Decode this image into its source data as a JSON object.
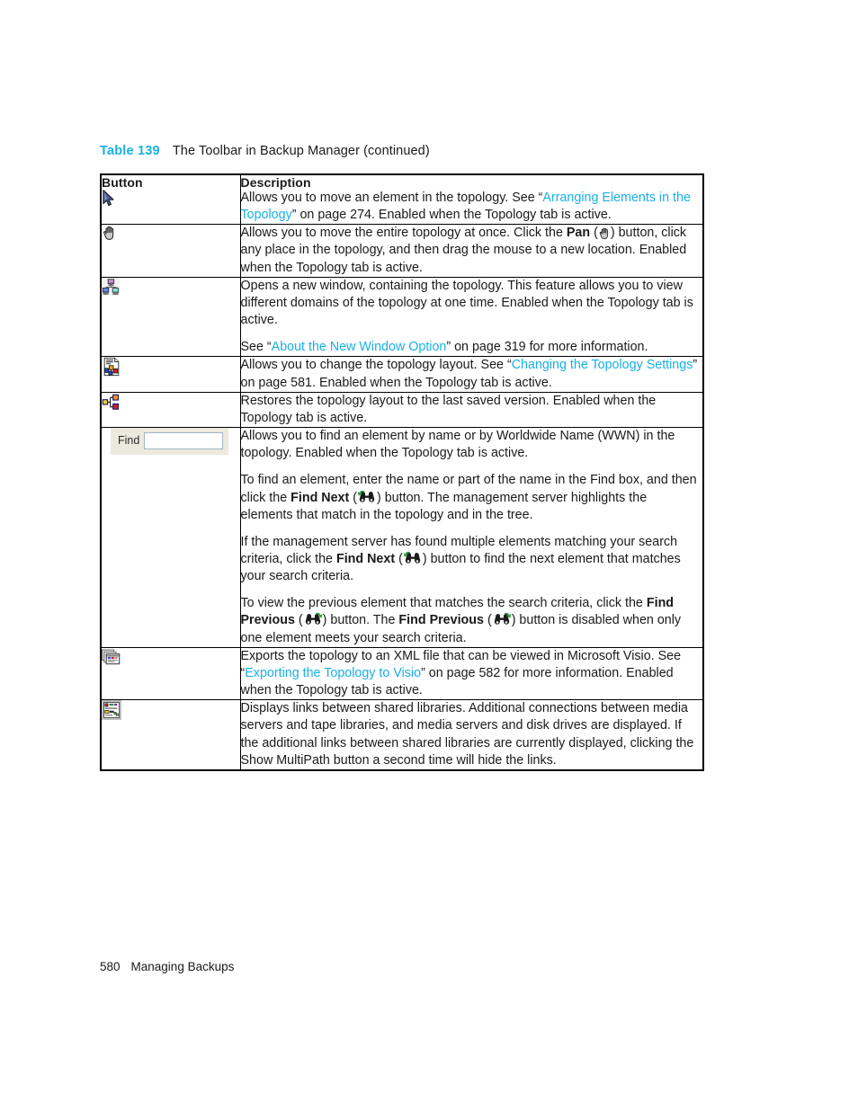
{
  "caption": {
    "table_number": "Table 139",
    "title": "The Toolbar in Backup Manager (continued)"
  },
  "colors": {
    "link": "#18b0e8",
    "caption_number": "#18b0e8",
    "text": "#1a1a1a",
    "border": "#000000",
    "find_widget_background": "#ece9dd",
    "find_input_border": "#9fb6c8"
  },
  "table": {
    "headers": {
      "button": "Button",
      "description": "Description"
    },
    "rows": [
      {
        "icon_name": "select-arrow-icon",
        "paragraphs": [
          [
            {
              "t": "Allows you to move an element in the topology. See “",
              "s": "n"
            },
            {
              "t": "Arranging Elements in the Topology",
              "s": "link"
            },
            {
              "t": "” on page 274. Enabled when the Topology tab is active.",
              "s": "n"
            }
          ]
        ]
      },
      {
        "icon_name": "pan-hand-icon",
        "paragraphs": [
          [
            {
              "t": "Allows you to move the entire topology at once. Click the ",
              "s": "n"
            },
            {
              "t": "Pan",
              "s": "bold"
            },
            {
              "t": " (",
              "s": "n"
            },
            {
              "t": "pan-hand-icon",
              "s": "icon"
            },
            {
              "t": ") button, click any place in the topology, and then drag the mouse to a new location. Enabled when the Topology tab is active.",
              "s": "n"
            }
          ]
        ]
      },
      {
        "icon_name": "new-window-icon",
        "paragraphs": [
          [
            {
              "t": "Opens a new window, containing the topology. This feature allows you to view different domains of the topology at one time. Enabled when the Topology tab is active.",
              "s": "n"
            }
          ],
          [
            {
              "t": "See “",
              "s": "n"
            },
            {
              "t": "About the New Window Option",
              "s": "link"
            },
            {
              "t": "” on page 319 for more information.",
              "s": "n"
            }
          ]
        ]
      },
      {
        "icon_name": "topology-settings-icon",
        "paragraphs": [
          [
            {
              "t": "Allows you to change the topology layout. See “",
              "s": "n"
            },
            {
              "t": "Changing the Topology Settings",
              "s": "link"
            },
            {
              "t": "” on page 581. Enabled when the Topology tab is active.",
              "s": "n"
            }
          ]
        ]
      },
      {
        "icon_name": "restore-layout-icon",
        "paragraphs": [
          [
            {
              "t": "Restores the topology layout to the last saved version. Enabled when the Topology tab is active.",
              "s": "n"
            }
          ]
        ]
      },
      {
        "icon_name": "find-box",
        "find_widget": {
          "label": "Find",
          "value": "",
          "placeholder": ""
        },
        "paragraphs": [
          [
            {
              "t": "Allows you to find an element by name or by Worldwide Name (WWN) in the topology. Enabled when the Topology tab is active.",
              "s": "n"
            }
          ],
          [
            {
              "t": "To find an element, enter the name or part of the name in the Find box, and then click the ",
              "s": "n"
            },
            {
              "t": "Find Next",
              "s": "bold"
            },
            {
              "t": " (",
              "s": "n"
            },
            {
              "t": "find-next-icon",
              "s": "icon"
            },
            {
              "t": ") button. The management server highlights the elements that match in the topology and in the tree.",
              "s": "n"
            }
          ],
          [
            {
              "t": "If the management server has found multiple elements matching your search criteria, click the ",
              "s": "n"
            },
            {
              "t": "Find Next",
              "s": "bold"
            },
            {
              "t": " (",
              "s": "n"
            },
            {
              "t": "find-next-icon",
              "s": "icon"
            },
            {
              "t": ") button to find the next element that matches your search criteria.",
              "s": "n"
            }
          ],
          [
            {
              "t": "To view the previous element that matches the search criteria, click the ",
              "s": "n"
            },
            {
              "t": "Find Previous",
              "s": "bold"
            },
            {
              "t": " (",
              "s": "n"
            },
            {
              "t": "find-previous-icon",
              "s": "icon"
            },
            {
              "t": ") button. The ",
              "s": "n"
            },
            {
              "t": "Find Previous",
              "s": "bold"
            },
            {
              "t": " (",
              "s": "n"
            },
            {
              "t": "find-previous-icon",
              "s": "icon"
            },
            {
              "t": ") button is disabled when only one element meets your search criteria.",
              "s": "n"
            }
          ]
        ]
      },
      {
        "icon_name": "export-visio-icon",
        "paragraphs": [
          [
            {
              "t": "Exports the topology to an XML file that can be viewed in Microsoft Visio. See “",
              "s": "n"
            },
            {
              "t": "Exporting the Topology to Visio",
              "s": "link"
            },
            {
              "t": "” on page 582 for more information. Enabled when the Topology tab is active.",
              "s": "n"
            }
          ]
        ]
      },
      {
        "icon_name": "show-multipath-icon",
        "paragraphs": [
          [
            {
              "t": "Displays links between shared libraries. Additional connections between media servers and tape libraries, and media servers and disk drives are displayed. If the additional links between shared libraries are currently displayed, clicking the Show MultiPath button a second time will hide the links.",
              "s": "n"
            }
          ]
        ]
      }
    ]
  },
  "footer": {
    "page_number": "580",
    "section": "Managing Backups"
  }
}
